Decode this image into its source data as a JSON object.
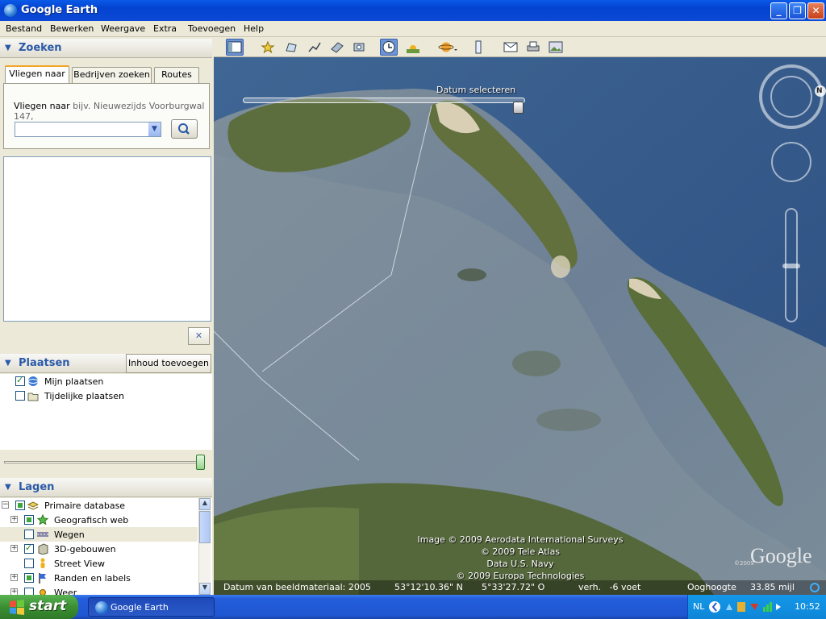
{
  "window": {
    "title": "Google Earth",
    "min": "_",
    "max": "❐",
    "close": "✕"
  },
  "menu": [
    "Bestand",
    "Bewerken",
    "Weergave",
    "Extra",
    "Toevoegen",
    "Help"
  ],
  "search": {
    "header": "Zoeken",
    "tabs": [
      "Vliegen naar",
      "Bedrijven zoeken",
      "Routes"
    ],
    "prompt_label": "Vliegen naar",
    "prompt_example": "bijv. Nieuwezijds Voorburgwal 147,",
    "input_value": "",
    "close_label": "✕"
  },
  "places": {
    "header": "Plaatsen",
    "add_button": "Inhoud toevoegen",
    "items": [
      {
        "label": "Mijn plaatsen",
        "checked": true
      },
      {
        "label": "Tijdelijke plaatsen",
        "checked": false
      }
    ]
  },
  "layers": {
    "header": "Lagen",
    "items": [
      {
        "label": "Primaire database",
        "expander": "−",
        "state": "partial"
      },
      {
        "label": "Geografisch web",
        "expander": "+",
        "state": "partial"
      },
      {
        "label": "Wegen",
        "expander": "",
        "state": "unchecked"
      },
      {
        "label": "3D-gebouwen",
        "expander": "+",
        "state": "checked"
      },
      {
        "label": "Street View",
        "expander": "",
        "state": "unchecked"
      },
      {
        "label": "Randen en labels",
        "expander": "+",
        "state": "partial"
      },
      {
        "label": "Weer",
        "expander": "+",
        "state": "unchecked"
      }
    ]
  },
  "map": {
    "time_slider_label": "Datum selecteren",
    "compass_north": "N",
    "credits": [
      "Image © 2009 Aerodata International Surveys",
      "© 2009 Tele Atlas",
      "Data U.S. Navy",
      "© 2009 Europa Technologies"
    ],
    "logo": "Google",
    "logo_small": "©2009",
    "status": {
      "imagery_date": "Datum van beeldmateriaal: 2005",
      "lat": "53°12'10.36\" N",
      "lon": "5°33'27.72\" O",
      "elevation": "verh.   -6 voet",
      "eye_alt_label": "Ooghoogte",
      "eye_alt": "33.85 mijl"
    }
  },
  "taskbar": {
    "start": "start",
    "app": "Google Earth",
    "language": "NL",
    "clock": "10:52"
  }
}
